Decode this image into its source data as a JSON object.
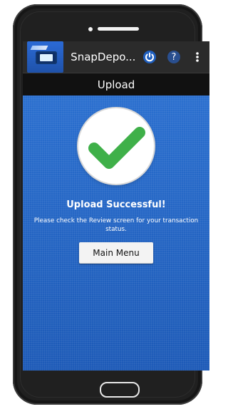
{
  "app": {
    "name": "SnapDepo...",
    "icon": "snapdeposit-app-icon"
  },
  "actionbar": {
    "power_icon": "power-icon",
    "help_icon": "help-icon",
    "overflow_icon": "more-vertical-icon"
  },
  "screen": {
    "title": "Upload"
  },
  "result": {
    "icon": "check-icon",
    "heading": "Upload Successful!",
    "message": "Please check the Review screen for your transaction status."
  },
  "buttons": {
    "main_menu": "Main Menu"
  },
  "colors": {
    "accent_blue": "#1f5fbf",
    "check_green": "#3fb049",
    "titlebar_black": "#111111"
  }
}
